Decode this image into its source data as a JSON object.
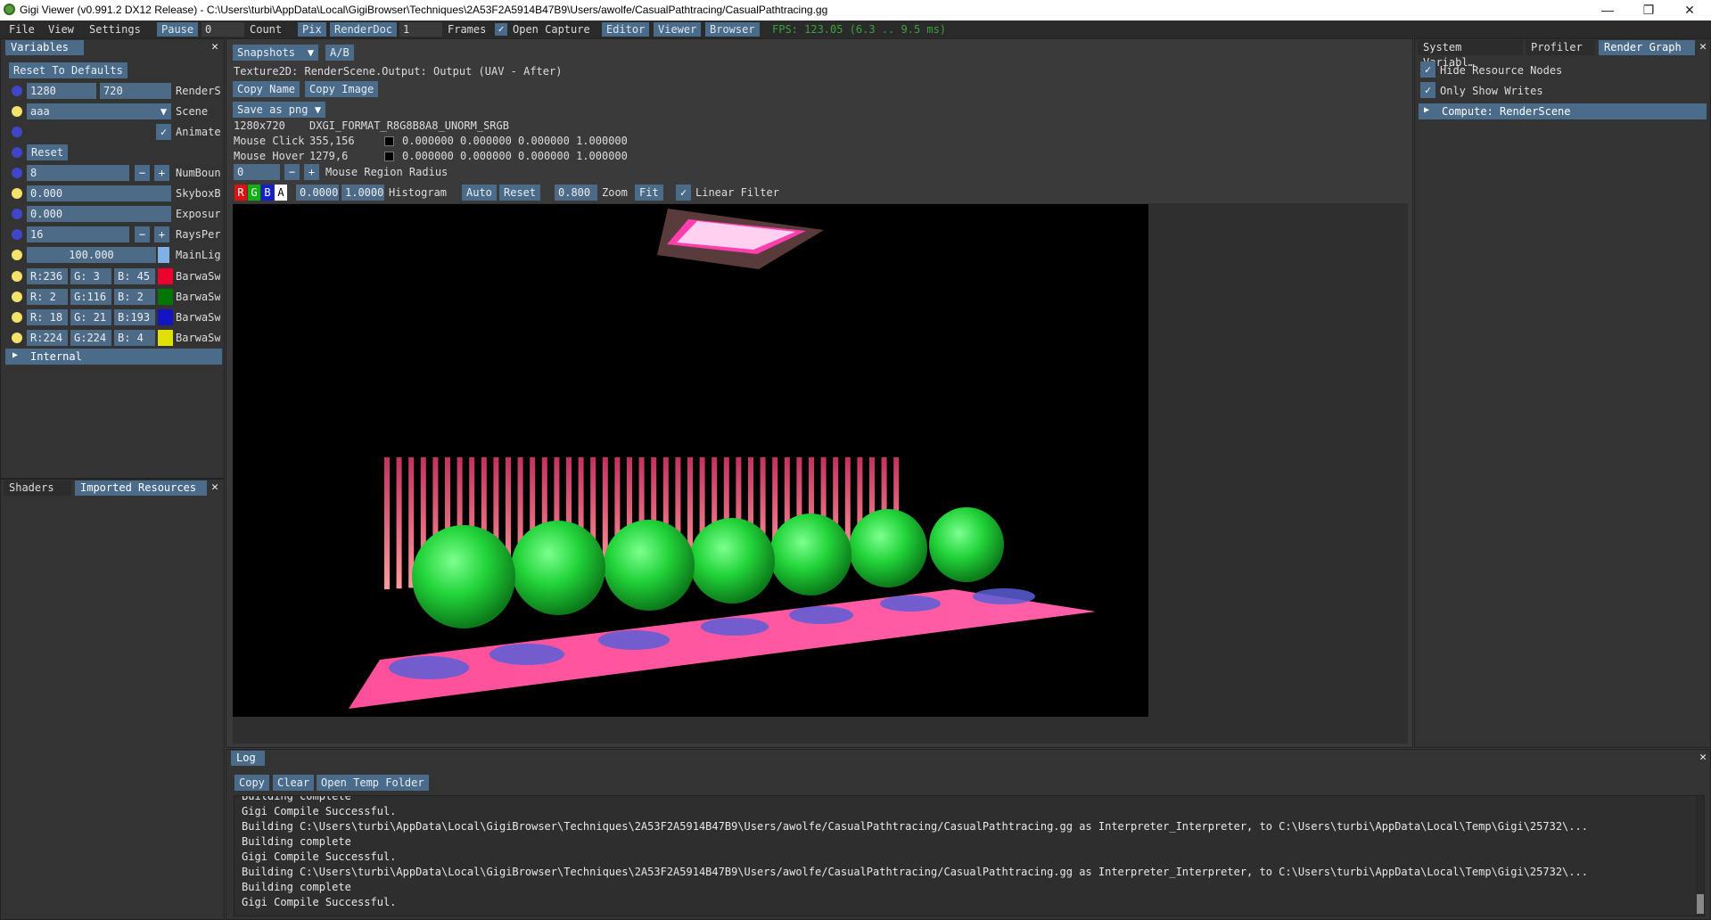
{
  "window": {
    "title": "Gigi Viewer (v0.991.2 DX12 Release) - C:\\Users\\turbi\\AppData\\Local\\GigiBrowser\\Techniques\\2A53F2A5914B47B9\\Users/awolfe/CasualPathtracing/CasualPathtracing.gg",
    "min": "—",
    "max": "❐",
    "close": "✕"
  },
  "menubar": {
    "file": "File",
    "view": "View",
    "settings": "Settings",
    "pause": "Pause",
    "pause_count_value": "0",
    "count": "Count",
    "pix": "Pix",
    "renderdoc": "RenderDoc",
    "frames_value": "1",
    "frames": "Frames",
    "open_capture": "Open Capture",
    "editor": "Editor",
    "viewer": "Viewer",
    "browser": "Browser",
    "fps": "FPS: 123.05 (6.3 .. 9.5 ms)"
  },
  "variables": {
    "tab": "Variables",
    "reset_defaults": "Reset To Defaults",
    "render_w": "1280",
    "render_h": "720",
    "render_size_label": "RenderSize",
    "scene_value": "aaa",
    "scene_label": "Scene",
    "animate_label": "Animate",
    "reset": "Reset",
    "num_bounces_value": "8",
    "num_bounces_label": "NumBounces",
    "skybox_value": "0.000",
    "skybox_label": "SkyboxBrightness",
    "exposure_value": "0.000",
    "exposure_label": "Exposure",
    "rays_value": "16",
    "rays_label": "RaysPerPixel",
    "mainlight_value": "100.000",
    "mainlight_label": "MainLight",
    "minus": "−",
    "plus": "+",
    "swatches": [
      {
        "r": "R:236",
        "g": "G:  3",
        "b": "B: 45",
        "color": "#ec032d",
        "label": "BarwaSwatch"
      },
      {
        "r": "R:  2",
        "g": "G:116",
        "b": "B:  2",
        "color": "#027402",
        "label": "BarwaSwatch"
      },
      {
        "r": "R: 18",
        "g": "G: 21",
        "b": "B:193",
        "color": "#1215c1",
        "label": "BarwaSwatch"
      },
      {
        "r": "R:224",
        "g": "G:224",
        "b": "B:  4",
        "color": "#e0e004",
        "label": "BarwaSwatch"
      }
    ],
    "internal": "Internal"
  },
  "bottom_left": {
    "shaders": "Shaders",
    "imported": "Imported Resources"
  },
  "center": {
    "snapshots": "Snapshots",
    "ab": "A/B",
    "texture_info": "Texture2D: RenderScene.Output: Output (UAV - After)",
    "copy_name": "Copy Name",
    "copy_image": "Copy Image",
    "save_as": "Save as png",
    "dims": "1280x720",
    "format": "DXGI_FORMAT_R8G8B8A8_UNORM_SRGB",
    "mouse_click_label": "Mouse Click",
    "mouse_click_pos": "355,156",
    "mouse_click_vals": "0.000000 0.000000 0.000000 1.000000",
    "mouse_hover_label": "Mouse Hover",
    "mouse_hover_pos": "1279,6",
    "mouse_hover_vals": "0.000000 0.000000 0.000000 1.000000",
    "radius_value": "0",
    "radius_label": "Mouse Region Radius",
    "ch_r": "R",
    "ch_g": "G",
    "ch_b": "B",
    "ch_a": "A",
    "hist_min": "0.0000",
    "hist_max": "1.0000",
    "histogram": "Histogram",
    "auto": "Auto",
    "reset": "Reset",
    "zoom_value": "0.800",
    "zoom": "Zoom",
    "fit": "Fit",
    "linear_filter": "Linear Filter",
    "colors": {
      "pink": "#ff4f9a",
      "green": "#22d43a",
      "ceiling": "#ffd0f0"
    }
  },
  "right": {
    "tab_system": "System Variabl…",
    "tab_profiler": "Profiler",
    "tab_render_graph": "Render Graph",
    "hide_resource_nodes": "Hide Resource Nodes",
    "only_show_writes": "Only Show Writes",
    "compute_node": "Compute: RenderScene"
  },
  "log": {
    "tab": "Log",
    "copy": "Copy",
    "clear": "Clear",
    "open_temp": "Open Temp Folder",
    "lines": [
      "Building complete",
      "Gigi Compile Successful.",
      "Building C:\\Users\\turbi\\AppData\\Local\\GigiBrowser\\Techniques\\2A53F2A5914B47B9\\Users/awolfe/CasualPathtracing/CasualPathtracing.gg as Interpreter_Interpreter, to C:\\Users\\turbi\\AppData\\Local\\Temp\\Gigi\\25732\\...",
      "Building complete",
      "Gigi Compile Successful.",
      "Building C:\\Users\\turbi\\AppData\\Local\\GigiBrowser\\Techniques\\2A53F2A5914B47B9\\Users/awolfe/CasualPathtracing/CasualPathtracing.gg as Interpreter_Interpreter, to C:\\Users\\turbi\\AppData\\Local\\Temp\\Gigi\\25732\\...",
      "Building complete",
      "Gigi Compile Successful."
    ]
  },
  "icons": {
    "check": "✓",
    "close": "✕",
    "arrow_down": "▼",
    "arrow_right": "▶"
  }
}
